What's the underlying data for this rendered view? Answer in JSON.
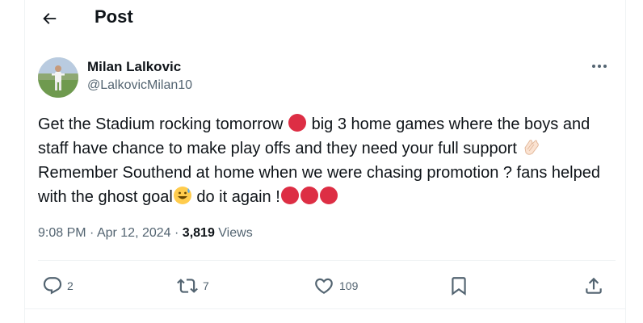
{
  "header": {
    "title": "Post"
  },
  "post": {
    "author_name": "Milan Lalkovic",
    "author_handle": "@LalkovicMilan10",
    "text_1": "Get the Stadium rocking tomorrow ",
    "text_2": " big 3 home games where the boys and staff have chance to make play offs and they need your full support ",
    "text_3": "Remember Southend at home when we were chasing promotion ? fans helped with the ghost goal",
    "text_4": " do it again !",
    "time": "9:08 PM",
    "date": "Apr 12, 2024",
    "sep": "·",
    "views_count": "3,819",
    "views_label": "Views"
  },
  "actions": {
    "replies": "2",
    "reposts": "7",
    "likes": "109"
  },
  "icons": [
    "back-arrow-icon",
    "more-icon",
    "red-circle-emoji",
    "clapping-hands-emoji",
    "grinning-sweat-emoji",
    "reply-icon",
    "repost-icon",
    "like-icon",
    "bookmark-icon",
    "share-icon"
  ],
  "colors": {
    "text": "#0f1419",
    "secondary": "#536471",
    "border": "#eff3f4",
    "emoji_red": "#dd2e44"
  }
}
